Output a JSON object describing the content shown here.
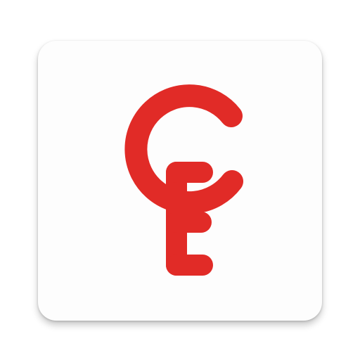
{
  "app_icon": {
    "icon": "ce-monogram-logo-icon",
    "logo_letters": "CE",
    "colors": {
      "tile_background": "#fdfdfd",
      "logo_red": "#e12b27",
      "page_background": "#ffffff"
    }
  }
}
